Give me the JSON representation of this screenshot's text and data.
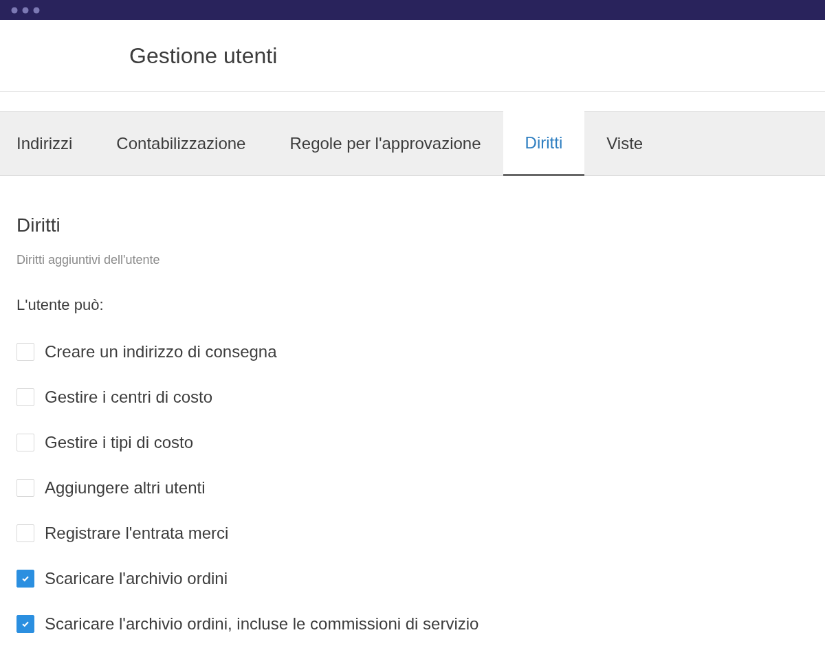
{
  "header": {
    "title": "Gestione utenti"
  },
  "tabs": [
    {
      "label": "Indirizzi",
      "selected": false
    },
    {
      "label": "Contabilizzazione",
      "selected": false
    },
    {
      "label": "Regole per l'approvazione",
      "selected": false
    },
    {
      "label": "Diritti",
      "selected": true
    },
    {
      "label": "Viste",
      "selected": false
    }
  ],
  "section": {
    "title": "Diritti",
    "subtitle": "Diritti aggiuntivi dell'utente",
    "intro": "L'utente può:"
  },
  "permissions": [
    {
      "label": "Creare un indirizzo di consegna",
      "checked": false
    },
    {
      "label": "Gestire i centri di costo",
      "checked": false
    },
    {
      "label": "Gestire i tipi di costo",
      "checked": false
    },
    {
      "label": "Aggiungere altri utenti",
      "checked": false
    },
    {
      "label": "Registrare l'entrata merci",
      "checked": false
    },
    {
      "label": "Scaricare l'archivio ordini",
      "checked": true
    },
    {
      "label": "Scaricare l'archivio ordini, incluse le commissioni di servizio",
      "checked": true
    }
  ]
}
